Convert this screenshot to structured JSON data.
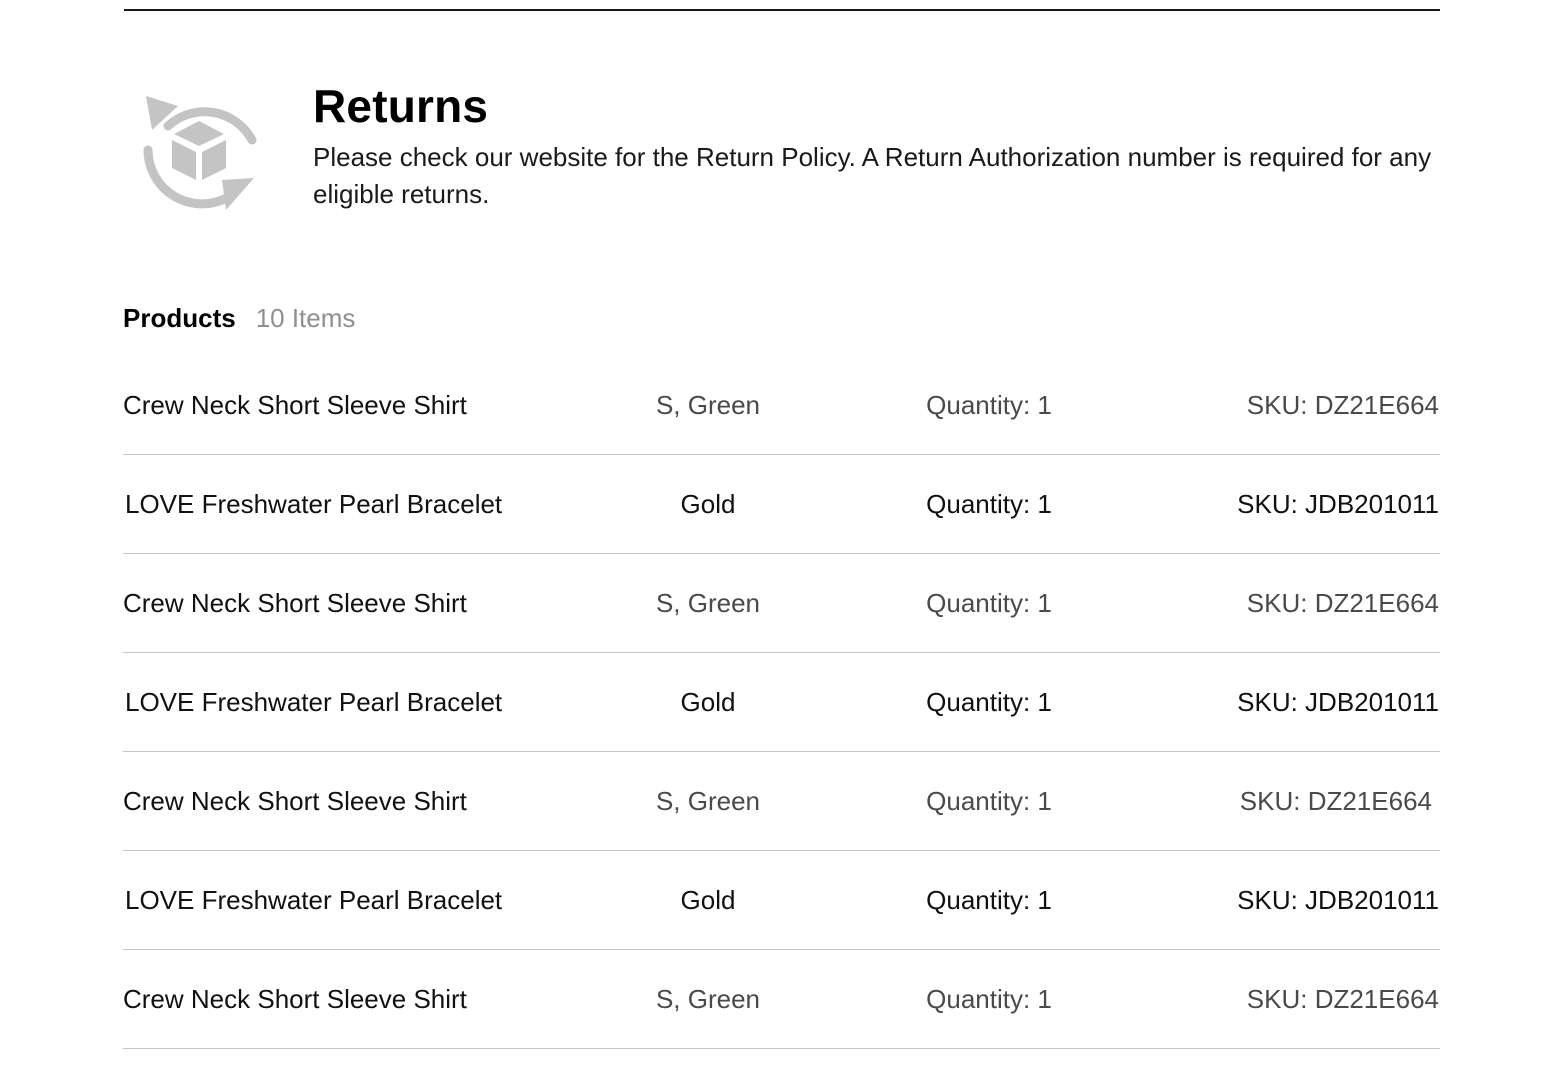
{
  "returns": {
    "icon": "box-return-arrows-icon",
    "icon_color": "#c4c4c4",
    "title": "Returns",
    "text": "Please check our website for the Return Policy. A Return Authorization number is required for any eligible returns."
  },
  "products": {
    "label": "Products",
    "count": "10 Items",
    "items": [
      {
        "name": "Crew Neck Short Sleeve Shirt",
        "variant": "S, Green",
        "quantity": "Quantity: 1",
        "sku": "SKU: DZ21E664"
      },
      {
        "name": "LOVE Freshwater Pearl Bracelet",
        "variant": "Gold",
        "quantity": "Quantity: 1",
        "sku": "SKU: JDB201011"
      },
      {
        "name": "Crew Neck Short Sleeve Shirt",
        "variant": "S, Green",
        "quantity": "Quantity: 1",
        "sku": "SKU: DZ21E664"
      },
      {
        "name": "LOVE Freshwater Pearl Bracelet",
        "variant": "Gold",
        "quantity": "Quantity: 1",
        "sku": "SKU: JDB201011"
      },
      {
        "name": "Crew Neck Short Sleeve Shirt",
        "variant": "S, Green",
        "quantity": "Quantity: 1",
        "sku": "SKU: DZ21E664"
      },
      {
        "name": "LOVE Freshwater Pearl Bracelet",
        "variant": "Gold",
        "quantity": "Quantity: 1",
        "sku": "SKU: JDB201011"
      },
      {
        "name": "Crew Neck Short Sleeve Shirt",
        "variant": "S, Green",
        "quantity": "Quantity: 1",
        "sku": "SKU: DZ21E664"
      }
    ]
  }
}
